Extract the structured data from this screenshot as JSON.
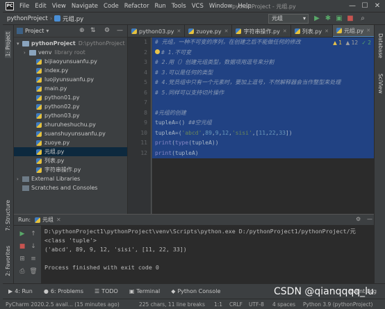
{
  "menubar": {
    "logo": "PC",
    "items": [
      "File",
      "Edit",
      "View",
      "Navigate",
      "Code",
      "Refactor",
      "Run",
      "Tools",
      "VCS",
      "Window",
      "Help"
    ],
    "window_title": "pythonProject - 元组.py",
    "controls": [
      "—",
      "☐",
      "✕"
    ]
  },
  "navbar": {
    "project": "pythonProject",
    "file": "元组.py",
    "run_config": "元组"
  },
  "left_strip": {
    "project": "1: Project",
    "structure": "7: Structure",
    "favorites": "2: Favorites"
  },
  "right_strip": {
    "database": "Database",
    "sciview": "SciView"
  },
  "project_panel": {
    "title": "Project",
    "tree": [
      {
        "kind": "folder",
        "label": "pythonProject",
        "suffix": "D:\\pythonProject",
        "indent": 0,
        "arrow": "▾",
        "bold": true
      },
      {
        "kind": "folder",
        "label": "venv",
        "suffix": "library root",
        "indent": 1,
        "arrow": "›"
      },
      {
        "kind": "py",
        "label": "bijiaoyunsuanfu.py",
        "indent": 2
      },
      {
        "kind": "py",
        "label": "index.py",
        "indent": 2
      },
      {
        "kind": "py",
        "label": "luojiyunsuanfu.py",
        "indent": 2
      },
      {
        "kind": "py",
        "label": "main.py",
        "indent": 2
      },
      {
        "kind": "py",
        "label": "python01.py",
        "indent": 2
      },
      {
        "kind": "py",
        "label": "python02.py",
        "indent": 2
      },
      {
        "kind": "py",
        "label": "python03.py",
        "indent": 2
      },
      {
        "kind": "py",
        "label": "shuruheshuchu.py",
        "indent": 2
      },
      {
        "kind": "py",
        "label": "suanshuyunsuanfu.py",
        "indent": 2
      },
      {
        "kind": "py",
        "label": "zuoye.py",
        "indent": 2
      },
      {
        "kind": "py",
        "label": "元组.py",
        "indent": 2,
        "selected": true
      },
      {
        "kind": "py",
        "label": "列表.py",
        "indent": 2
      },
      {
        "kind": "py",
        "label": "字符串操作.py",
        "indent": 2
      },
      {
        "kind": "lib",
        "label": "External Libraries",
        "indent": 0,
        "arrow": "›"
      },
      {
        "kind": "lib",
        "label": "Scratches and Consoles",
        "indent": 0,
        "arrow": ""
      }
    ]
  },
  "tabs": [
    {
      "label": "python03.py",
      "active": false
    },
    {
      "label": "zuoye.py",
      "active": false
    },
    {
      "label": "字符串操作.py",
      "active": false
    },
    {
      "label": "列表.py",
      "active": false
    },
    {
      "label": "元组.py",
      "active": true
    }
  ],
  "editor": {
    "inspections": {
      "warnings": "▲ 1",
      "weak": "▲ 12",
      "typos": "✓ 2"
    },
    "lines": [
      {
        "n": 1,
        "hl": true,
        "parts": [
          [
            "cm",
            "# 元组，一种不可变的序列，在创建之后不能做任何的修改"
          ]
        ]
      },
      {
        "n": 2,
        "hl": true,
        "parts": [
          [
            "cm",
            "#  1.不可变"
          ]
        ]
      },
      {
        "n": 3,
        "hl": true,
        "parts": [
          [
            "cm",
            "# 2.用（）创建元组类型，数据项用逗号来分割"
          ]
        ]
      },
      {
        "n": 4,
        "hl": true,
        "parts": [
          [
            "cm",
            "# 3.可以是任何的类型"
          ]
        ]
      },
      {
        "n": 5,
        "hl": true,
        "parts": [
          [
            "cm",
            "# 4.党员组中只有一个元素时，要加上逗号，不然解释器会当作整型来处理"
          ]
        ]
      },
      {
        "n": 6,
        "hl": true,
        "parts": [
          [
            "cm",
            "# 5.同样可以支持切片操作"
          ]
        ]
      },
      {
        "n": 7,
        "hl": true,
        "parts": [
          [
            "id",
            " "
          ]
        ]
      },
      {
        "n": 8,
        "hl": true,
        "parts": [
          [
            "cm",
            "#元组的创建"
          ]
        ]
      },
      {
        "n": 9,
        "hl": true,
        "parts": [
          [
            "id",
            "tupleA=()    "
          ],
          [
            "cm",
            "##空元组"
          ]
        ]
      },
      {
        "n": 10,
        "hl": true,
        "parts": [
          [
            "id",
            "tupleA=("
          ],
          [
            "str",
            "'abcd'"
          ],
          [
            "id",
            ","
          ],
          [
            "num",
            "89"
          ],
          [
            "id",
            ","
          ],
          [
            "num",
            "9"
          ],
          [
            "id",
            ","
          ],
          [
            "num",
            "12"
          ],
          [
            "id",
            ","
          ],
          [
            "str",
            "'sisi'"
          ],
          [
            "id",
            ",["
          ],
          [
            "num",
            "11"
          ],
          [
            "id",
            ","
          ],
          [
            "num",
            "22"
          ],
          [
            "id",
            ","
          ],
          [
            "num",
            "33"
          ],
          [
            "id",
            "])"
          ]
        ]
      },
      {
        "n": 11,
        "hl": true,
        "parts": [
          [
            "fn",
            "print"
          ],
          [
            "id",
            "("
          ],
          [
            "fn",
            "type"
          ],
          [
            "id",
            "(tupleA))"
          ]
        ]
      },
      {
        "n": 12,
        "hl": true,
        "parts": [
          [
            "fn",
            "print"
          ],
          [
            "id",
            "(tupleA)"
          ]
        ]
      }
    ]
  },
  "run_panel": {
    "label": "Run:",
    "tab": "元组",
    "output": [
      "D:\\pythonProject1\\pythonProject\\venv\\Scripts\\python.exe D:/pythonProject1/pythonProject/元",
      "<class 'tuple'>",
      "('abcd', 89, 9, 12, 'sisi', [11, 22, 33])",
      "",
      "Process finished with exit code 0"
    ]
  },
  "bottom_tabs": [
    {
      "icon": "▶",
      "label": "4: Run"
    },
    {
      "icon": "●",
      "label": "6: Problems"
    },
    {
      "icon": "☰",
      "label": "TODO"
    },
    {
      "icon": "▣",
      "label": "Terminal"
    },
    {
      "icon": "◆",
      "label": "Python Console"
    }
  ],
  "status": {
    "message": "PyCharm 2020.2.5 avail... (15 minutes ago)",
    "chars": "225 chars, 11 line breaks",
    "pos": "1:1",
    "eol": "CRLF",
    "enc": "UTF-8",
    "indent": "4 spaces",
    "interpreter": "Python 3.9 (pythonProject)",
    "event_log": "Event Log"
  },
  "watermark": "CSDN @qianqqqq_lu",
  "colors": {
    "accent": "#4a88c7",
    "selection": "#214283",
    "editor_bg": "#2b2b2b",
    "panel_bg": "#3c3f41"
  }
}
